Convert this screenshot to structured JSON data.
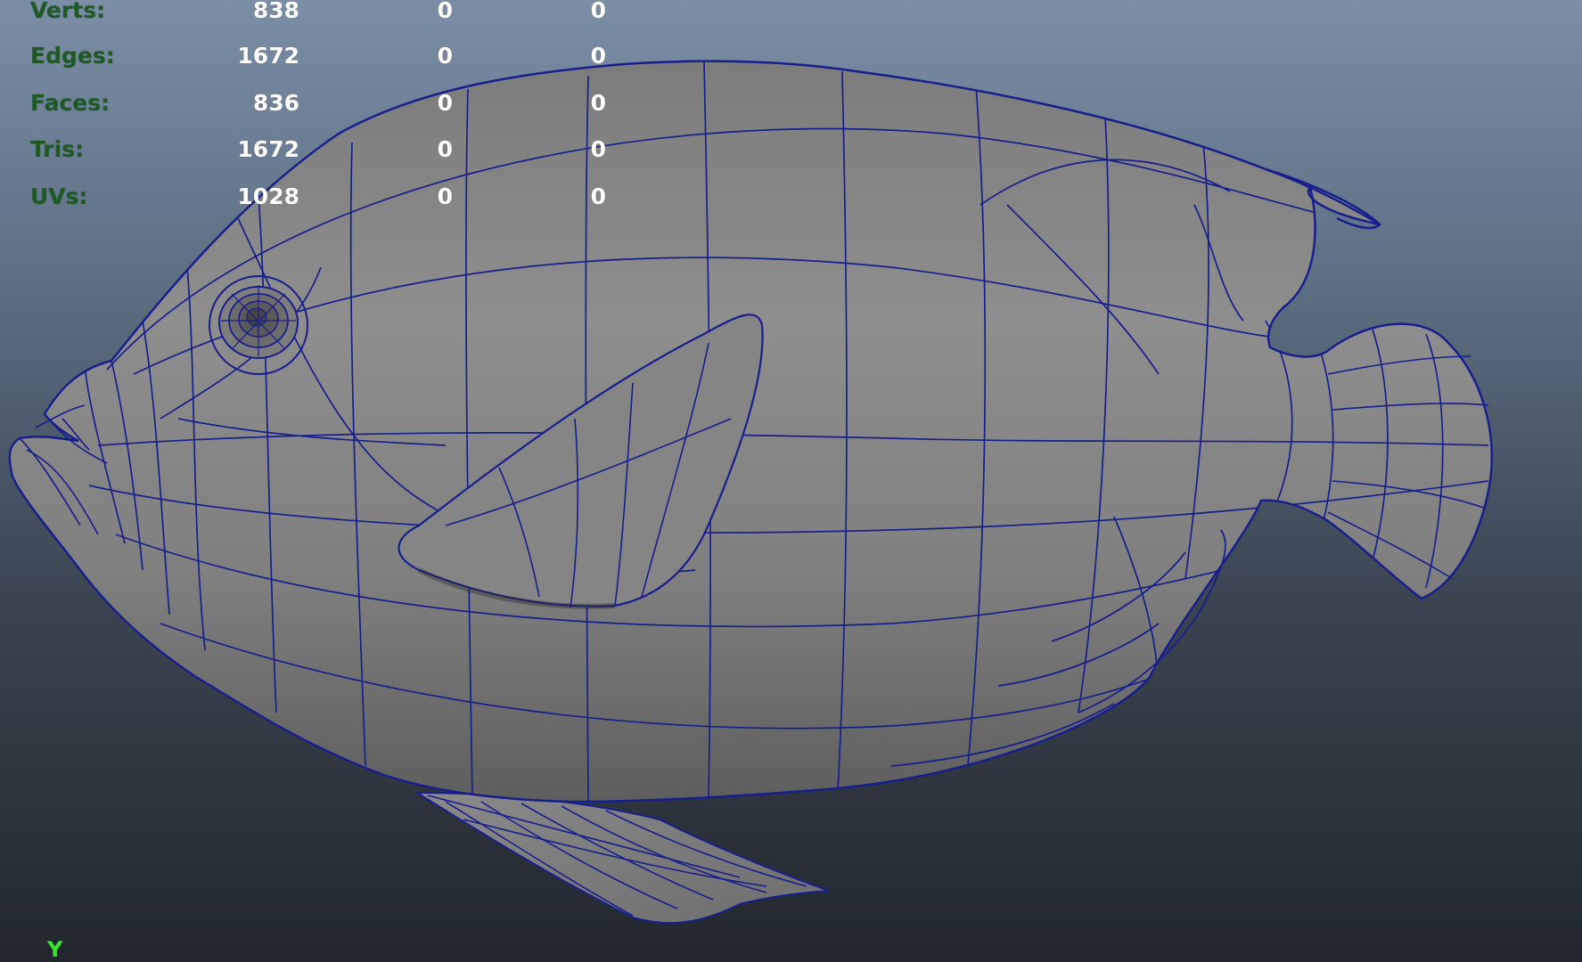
{
  "colors": {
    "label_green": "#1e5a26",
    "value_white": "#ffffff",
    "wireframe": "#161f8c",
    "mesh_fill": "#8a8a8a",
    "axis_green": "#35e82b"
  },
  "hud": {
    "rows": [
      {
        "label": "Verts:",
        "total": "838",
        "selected": "0",
        "component": "0"
      },
      {
        "label": "Edges:",
        "total": "1672",
        "selected": "0",
        "component": "0"
      },
      {
        "label": "Faces:",
        "total": "836",
        "selected": "0",
        "component": "0"
      },
      {
        "label": "Tris:",
        "total": "1672",
        "selected": "0",
        "component": "0"
      },
      {
        "label": "UVs:",
        "total": "1028",
        "selected": "0",
        "component": "0"
      }
    ]
  },
  "axis_indicator": {
    "label": "Y"
  },
  "model": {
    "icon": "fish-mesh-wireframe"
  }
}
